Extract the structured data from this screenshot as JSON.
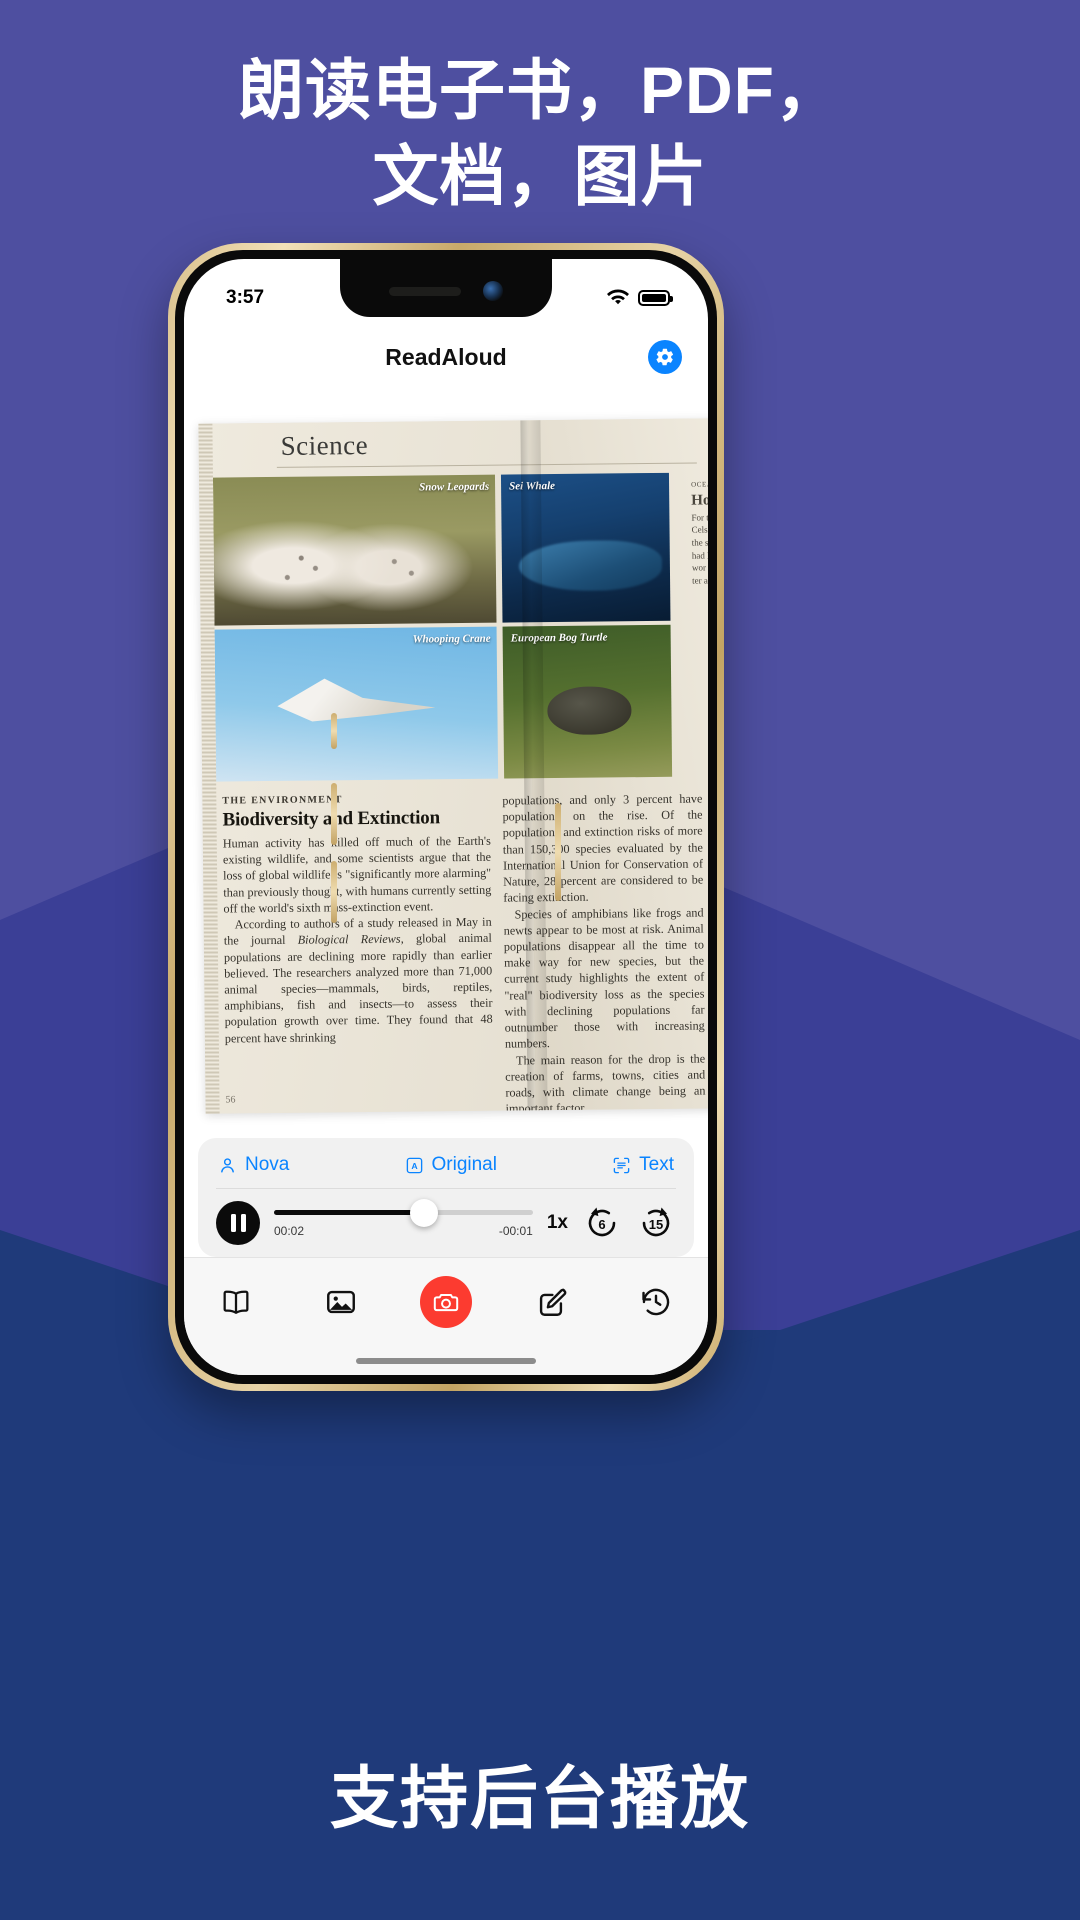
{
  "promo": {
    "headline_line1": "朗读电子书，PDF，",
    "headline_line2": "文档，图片",
    "footer_text": "支持后台播放",
    "bg_top_color": "#4e4fa0",
    "bg_mid_color": "#3b3f96",
    "bg_bottom_color": "#1f3a7a"
  },
  "statusbar": {
    "time": "3:57",
    "wifi_icon": "wifi-icon",
    "battery_icon": "battery-icon"
  },
  "header": {
    "title": "ReadAloud",
    "settings_icon": "gear-icon"
  },
  "document": {
    "section_header": "Science",
    "folio": "56",
    "photos": [
      {
        "caption": "Snow Leopards",
        "name": "photo-snow-leopards"
      },
      {
        "caption": "Sei Whale",
        "name": "photo-sei-whale"
      },
      {
        "caption": "Whooping Crane",
        "name": "photo-whooping-crane"
      },
      {
        "caption": "European Bog Turtle",
        "name": "photo-european-bog-turtle"
      }
    ],
    "article": {
      "kicker": "THE ENVIRONMENT",
      "title": "Biodiversity and Extinction",
      "col1_p1": "Human activity has killed off much of the Earth's existing wildlife, and some scientists argue that the loss of global wildlife is \"significantly more alarming\" than previously thought, with humans currently setting off the world's sixth mass-extinction event.",
      "col1_p2_a": "According to authors of a study released in May in the journal ",
      "col1_p2_i": "Biological Reviews",
      "col1_p2_b": ", global animal populations are declining more rapidly than earlier believed. The researchers analyzed more than 71,000 animal species—mammals, birds, reptiles, amphibians, fish and insects—to assess their population growth over time. They found that 48 percent have shrinking",
      "col2_p1": "populations, and only 3 percent have populations on the rise. Of the populations and extinction risks of more than 150,300 species evaluated by the International Union for Conservation of Nature, 28 percent are considered to be facing extinction.",
      "col2_p2": "Species of amphibians like frogs and newts appear to be most at risk. Animal populations disappear all the time to make way for new species, but the current study highlights the extent of \"real\" biodiversity loss as the species with declining populations far outnumber those with increasing numbers.",
      "col2_p3": "The main reason for the drop is the creation of farms, towns, cities and roads, with climate change being an important factor."
    },
    "far_column": {
      "kicker": "OCEANS",
      "head": "Hot",
      "lines": "For t hit b Celsi hotte the s Flor had like Jeff wor acc tio ter as in m"
    }
  },
  "player": {
    "voice_label": "Nova",
    "voice_icon": "person-icon",
    "mode_label": "Original",
    "mode_icon": "letter-a-box-icon",
    "text_label": "Text",
    "text_icon": "text-scan-icon",
    "playpause_icon": "pause-icon",
    "elapsed": "00:02",
    "remaining": "-00:01",
    "progress_percent": 58,
    "speed": "1x",
    "rewind_seconds": "6",
    "forward_seconds": "15",
    "rewind_icon": "rewind-6-icon",
    "forward_icon": "forward-15-icon",
    "accent_color": "#0a84ff"
  },
  "tabbar": {
    "items": [
      {
        "name": "tab-book",
        "icon": "book-icon"
      },
      {
        "name": "tab-photos",
        "icon": "photo-icon"
      },
      {
        "name": "tab-camera",
        "icon": "camera-icon"
      },
      {
        "name": "tab-compose",
        "icon": "compose-icon"
      },
      {
        "name": "tab-history",
        "icon": "history-icon"
      }
    ],
    "camera_color": "#fc3b30"
  }
}
